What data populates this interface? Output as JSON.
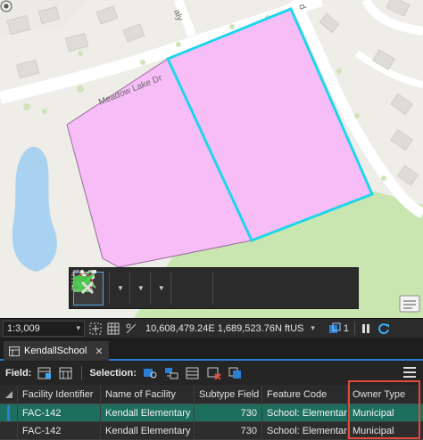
{
  "map": {
    "road_label": "Meadow Lake Dr",
    "road_label_fragment": "aly",
    "road_label_fragment2": "d",
    "colors": {
      "background": "#eeede8",
      "parcel_fill": "#f7bdf7",
      "parcel_outline": "#1fd6ea",
      "green_area": "#c9e6b0",
      "water": "#a9d2f0",
      "building": "#dedcd6"
    }
  },
  "edit_toolbar": {
    "tools": [
      {
        "name": "line",
        "selected": true
      },
      {
        "name": "polyline"
      },
      {
        "name": "arc"
      },
      {
        "name": "polygon-vertex"
      },
      {
        "name": "finish-part"
      },
      {
        "name": "finish-sketch"
      },
      {
        "name": "cancel-sketch"
      }
    ]
  },
  "status_bar": {
    "scale": "1:3,009",
    "coordinates": "10,608,479.24E 1,689,523.76N ftUS",
    "selected_count": "1"
  },
  "table": {
    "tab_label": "KendallSchool",
    "field_label": "Field:",
    "selection_label": "Selection:",
    "columns": [
      "Facility Identifier",
      "Name of Facility",
      "Subtype Field",
      "Feature Code",
      "Owner Type"
    ],
    "rows": [
      {
        "facility_id": "FAC-142",
        "name": "Kendall Elementary",
        "subtype": "730",
        "feature_code": "School: Elementary",
        "owner_type": "Municipal"
      },
      {
        "facility_id": "FAC-142",
        "name": "Kendall Elementary",
        "subtype": "730",
        "feature_code": "School: Elementary",
        "owner_type": "Municipal"
      }
    ]
  },
  "colors": {
    "accent": "#2a7fd4",
    "selected_row": "#1c6f5e",
    "highlight_box": "#e04a3a"
  }
}
